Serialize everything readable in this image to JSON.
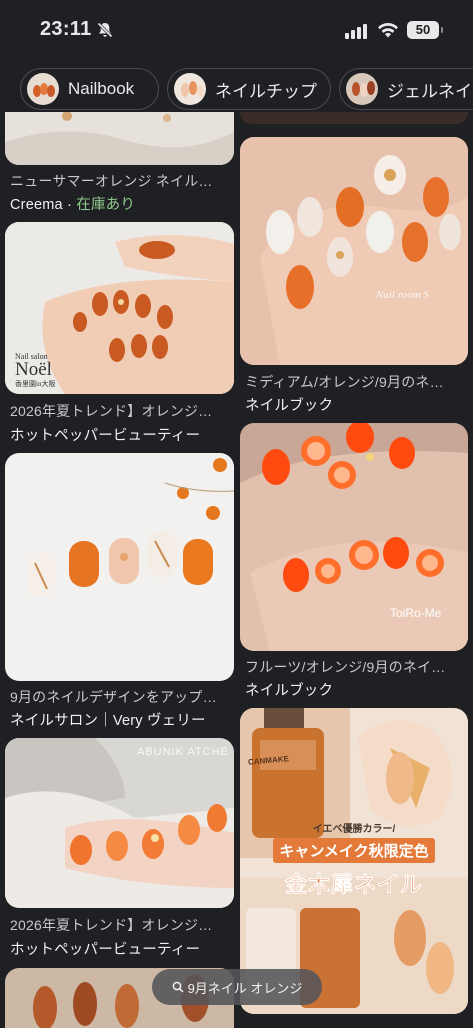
{
  "status_bar": {
    "time": "23:11",
    "battery": "50"
  },
  "chips": [
    {
      "label": "Nailbook"
    },
    {
      "label": "ネイルチップ"
    },
    {
      "label": "ジェルネイル"
    }
  ],
  "results": [
    {
      "caption": "ニューサマーオレンジ ネイル…",
      "source": "Creema",
      "stock": "在庫あり"
    },
    {
      "caption": "ミディアム/オレンジ/9月のネ…",
      "source": "ネイルブック"
    },
    {
      "caption": "2026年夏トレンド】オレンジ…",
      "source": "ホットペッパービューティー",
      "image_text": [
        "Nail salon",
        "Noël",
        "香里園in大阪"
      ]
    },
    {
      "caption": "フルーツ/オレンジ/9月のネイ…",
      "source": "ネイルブック",
      "image_text": [
        "ToiRo-Me"
      ]
    },
    {
      "caption": "9月のネイルデザインをアップ…",
      "source": "ネイルサロン｜Very ヴェリー"
    },
    {
      "caption": "2026年夏トレンド】オレンジ…",
      "source": "ホットペッパービューティー",
      "image_text": [
        "ABUNIK ATCHE"
      ]
    },
    {
      "image_text": [
        "イエベ優勝カラー/",
        "キャンメイク秋限定色",
        "金木犀ネイル",
        "CANMAKE"
      ]
    }
  ],
  "watermark_r1": "Nail room S",
  "search_pill": {
    "text": "9月ネイル オレンジ"
  },
  "colors": {
    "background": "#1f2023",
    "nail_orange": "#e0662a",
    "stock_green": "#8fc98f"
  }
}
